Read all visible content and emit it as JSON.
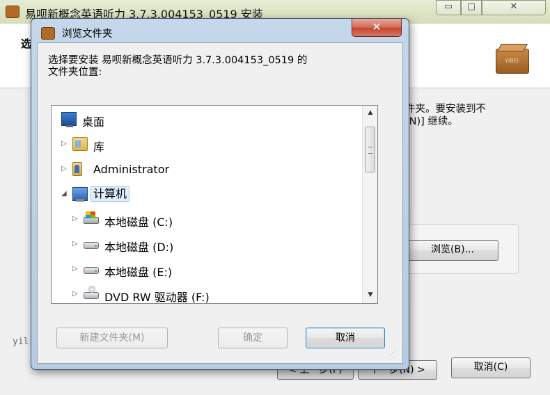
{
  "background_window": {
    "title": "易呗新概念英语听力 3.7.3.004153_0519 安装",
    "controls": {
      "minimize": "▭",
      "maximize": "▢",
      "close": "✕"
    },
    "header_title": "选",
    "box_icon_label": "YIBEI",
    "description": "件夹。要安装到不\n[N)] 继续。",
    "browse_button": "浏览(B)...",
    "brand_text": "yil",
    "back_button": "< 上一步(P)",
    "next_button": "下一步(N) >",
    "cancel_button": "取消(C)"
  },
  "dialog": {
    "title": "浏览文件夹",
    "close_glyph": "✕",
    "prompt": "选择要安装 易呗新概念英语听力 3.7.3.004153_0519 的\n文件夹位置:",
    "tree": [
      {
        "label": "桌面",
        "icon": "desktop-icon",
        "expander": "",
        "selected": false
      },
      {
        "label": "库",
        "icon": "library-icon",
        "expander": "▷",
        "selected": false
      },
      {
        "label": "Administrator",
        "icon": "user-folder-icon",
        "expander": "▷",
        "selected": false
      },
      {
        "label": "计算机",
        "icon": "computer-icon",
        "expander": "◢",
        "selected": true
      },
      {
        "label": "本地磁盘 (C:)",
        "icon": "system-drive-icon",
        "expander": "▷",
        "selected": false
      },
      {
        "label": "本地磁盘 (D:)",
        "icon": "hard-drive-icon",
        "expander": "▷",
        "selected": false
      },
      {
        "label": "本地磁盘 (E:)",
        "icon": "hard-drive-icon",
        "expander": "▷",
        "selected": false
      },
      {
        "label": "DVD RW 驱动器 (F:)",
        "icon": "dvd-drive-icon",
        "expander": "▷",
        "selected": false
      }
    ],
    "scroll_up": "▲",
    "scroll_down": "▼",
    "new_folder_button": "新建文件夹(M)",
    "ok_button": "确定",
    "cancel_button": "取消",
    "resize_grip": "⋰"
  }
}
